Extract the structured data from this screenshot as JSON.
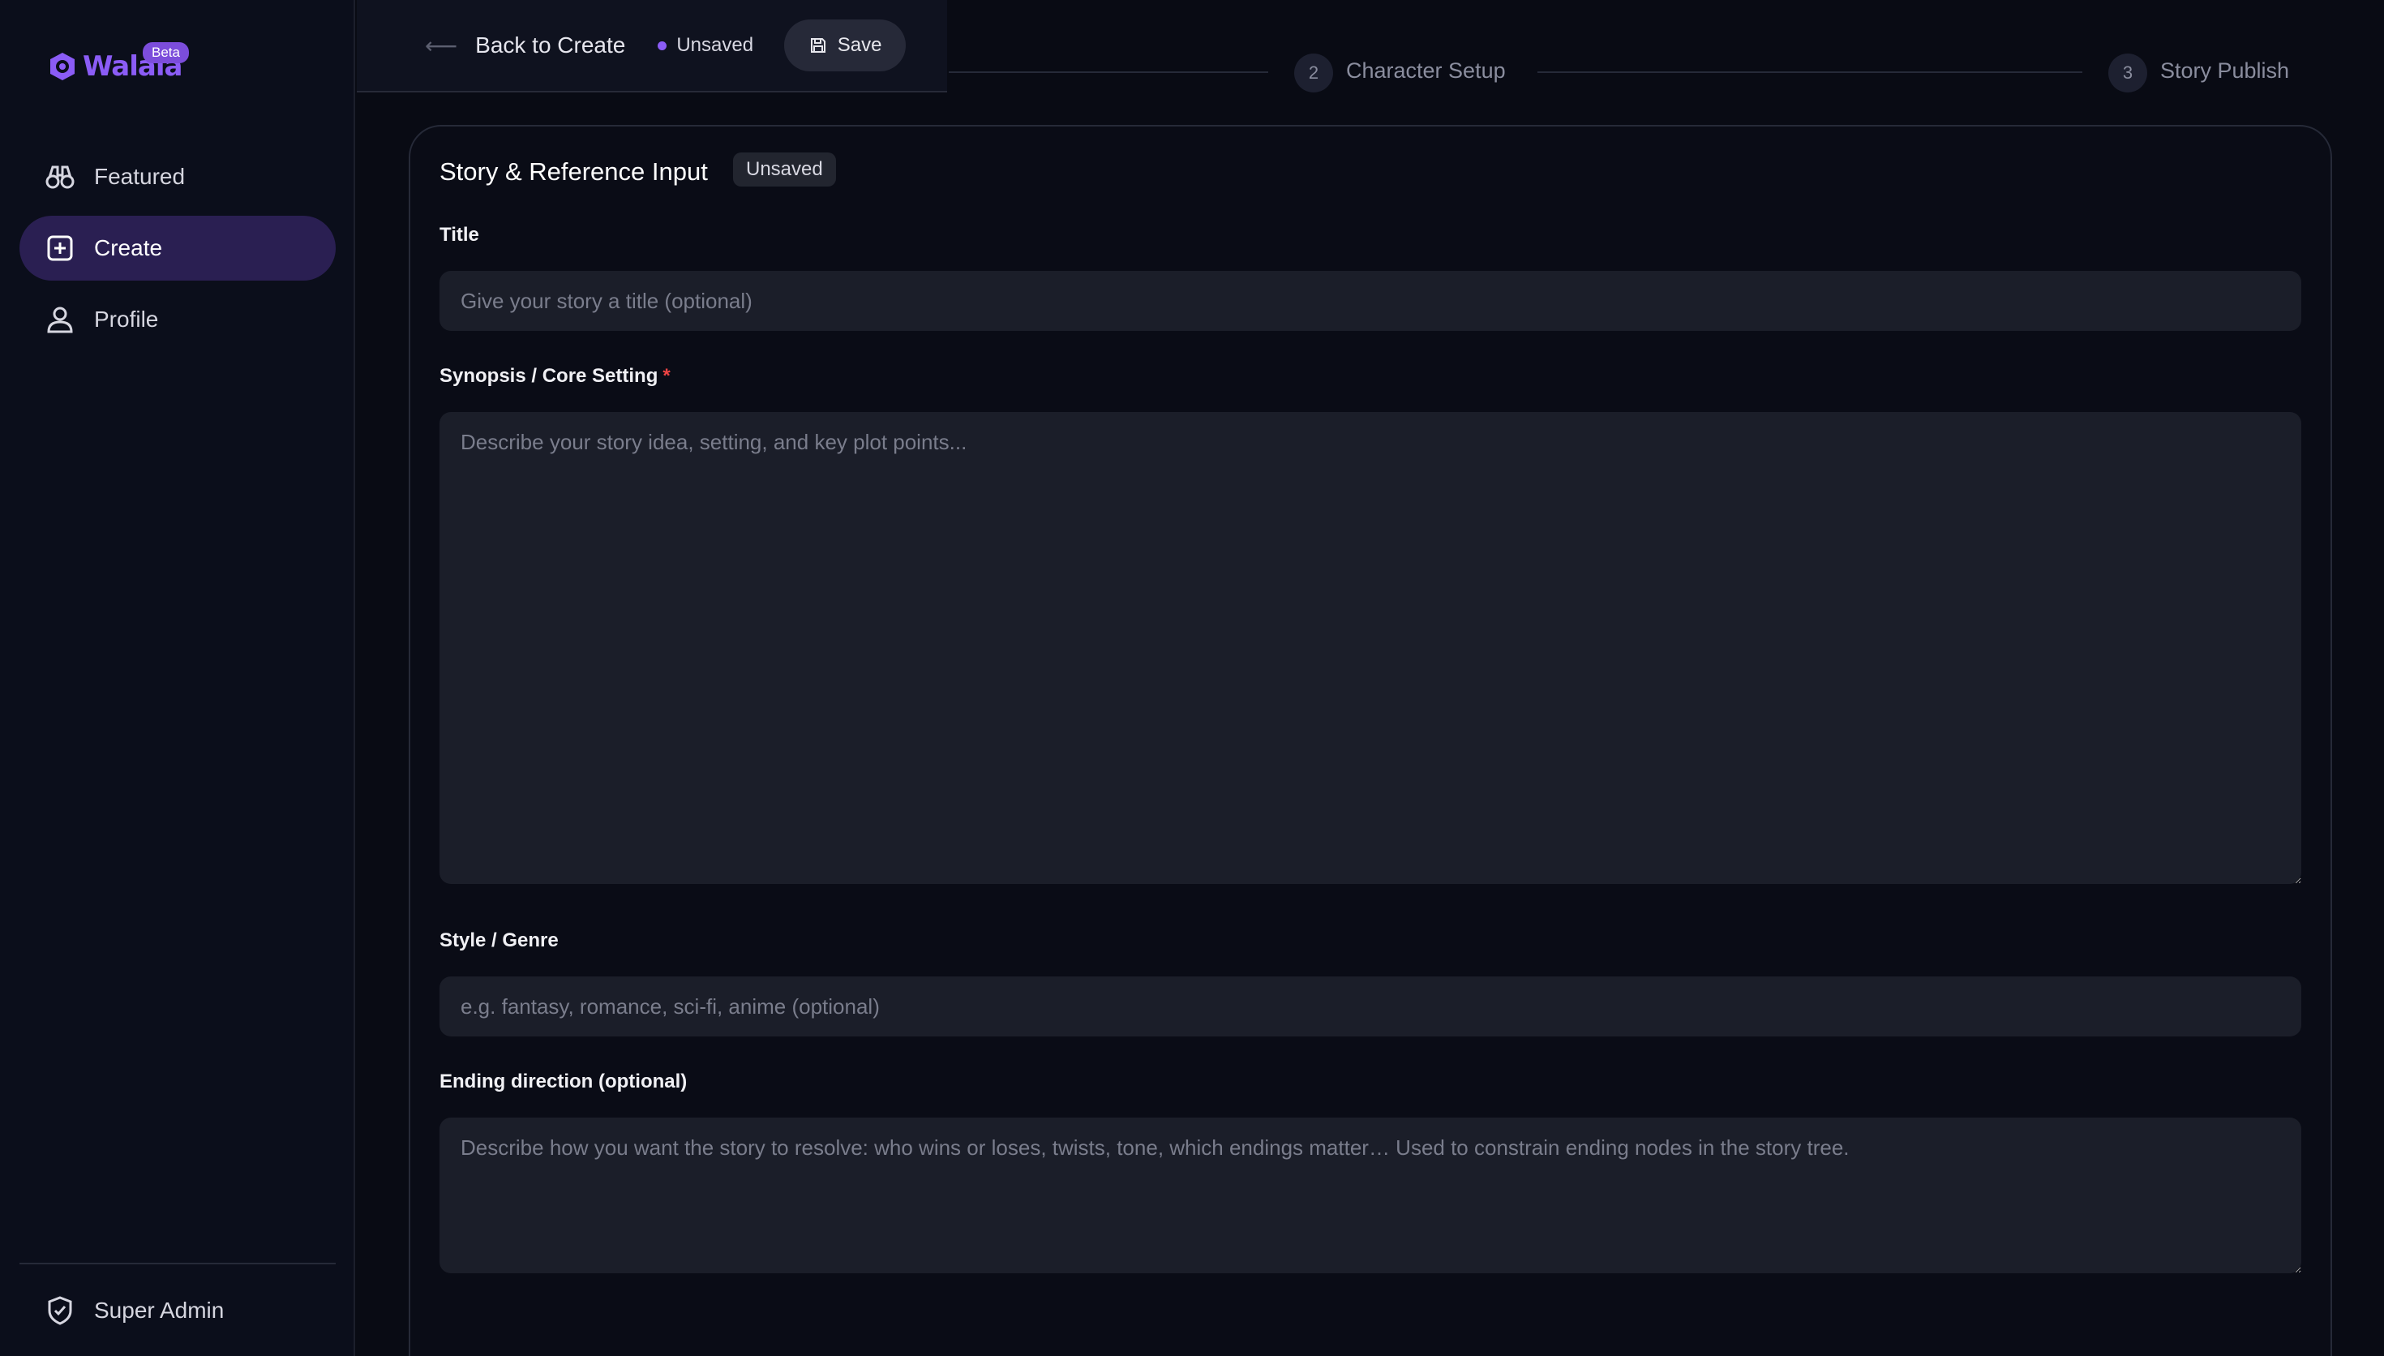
{
  "brand": {
    "name": "Walala",
    "badge": "Beta",
    "color": "#8b5cf6"
  },
  "sidebar": {
    "items": [
      {
        "label": "Featured",
        "icon": "binoculars-icon",
        "active": false
      },
      {
        "label": "Create",
        "icon": "plus-square-icon",
        "active": true
      },
      {
        "label": "Profile",
        "icon": "user-icon",
        "active": false
      }
    ],
    "footer": {
      "label": "Super Admin",
      "icon": "shield-check-icon"
    }
  },
  "topbar": {
    "back_label": "Back to Create",
    "status": "Unsaved",
    "save_label": "Save"
  },
  "steps": [
    {
      "number": "2",
      "label": "Character Setup"
    },
    {
      "number": "3",
      "label": "Story Publish"
    }
  ],
  "form": {
    "title": "Story & Reference Input",
    "badge": "Unsaved",
    "fields": {
      "title": {
        "label": "Title",
        "value": "",
        "placeholder": "Give your story a title (optional)"
      },
      "synopsis": {
        "label": "Synopsis / Core Setting",
        "required_mark": "*",
        "value": "",
        "placeholder": "Describe your story idea, setting, and key plot points..."
      },
      "style": {
        "label": "Style / Genre",
        "value": "",
        "placeholder": "e.g. fantasy, romance, sci-fi, anime (optional)"
      },
      "ending": {
        "label": "Ending direction (optional)",
        "value": "",
        "placeholder": "Describe how you want the story to resolve: who wins or loses, twists, tone, which endings matter… Used to constrain ending nodes in the story tree."
      }
    }
  }
}
